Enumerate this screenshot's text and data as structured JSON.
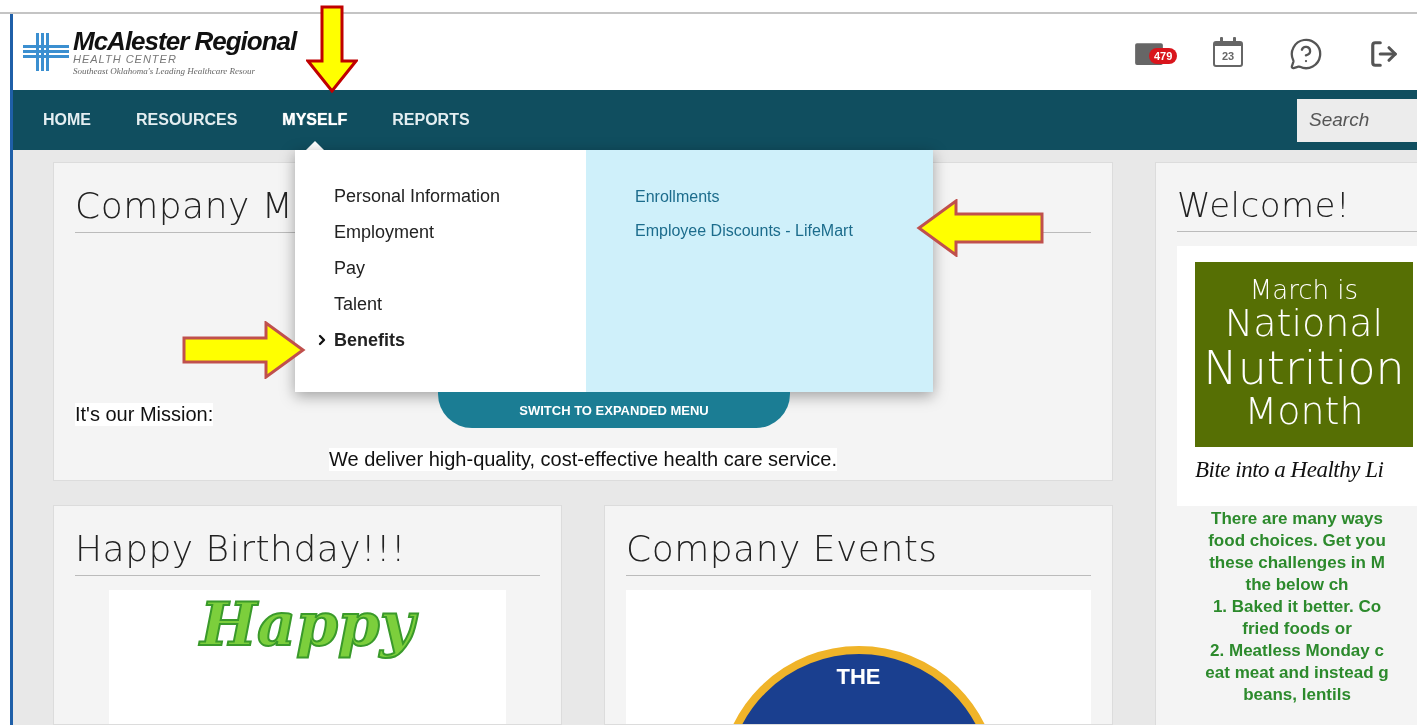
{
  "header": {
    "logo": {
      "name": "McAlester Regional",
      "subtitle": "HEALTH CENTER",
      "tagline": "Southeast Oklahoma's Leading Healthcare Resour"
    },
    "mail_badge": "479",
    "calendar_day": "23"
  },
  "nav": {
    "items": [
      {
        "label": "HOME",
        "selected": false
      },
      {
        "label": "RESOURCES",
        "selected": false
      },
      {
        "label": "MYSELF",
        "selected": true
      },
      {
        "label": "REPORTS",
        "selected": false
      }
    ],
    "search": {
      "placeholder": "Search"
    }
  },
  "dropdown": {
    "left_items": [
      {
        "label": "Personal Information",
        "selected": false
      },
      {
        "label": "Employment",
        "selected": false
      },
      {
        "label": "Pay",
        "selected": false
      },
      {
        "label": "Talent",
        "selected": false
      },
      {
        "label": "Benefits",
        "selected": true
      }
    ],
    "right_items": [
      "Enrollments",
      "Employee Discounts - LifeMart"
    ],
    "switch_button": "SWITCH TO EXPANDED MENU"
  },
  "mission_card": {
    "title": "Company M",
    "label": "It's our Mission:",
    "statement": "We deliver high-quality, cost-effective health care service."
  },
  "birthday_card": {
    "title": "Happy Birthday!!!",
    "image_text": "Happy"
  },
  "events_card": {
    "title": "Company Events",
    "image_text": "THE"
  },
  "welcome_card": {
    "title": "Welcome!",
    "poster": {
      "lines": [
        "March is",
        "National",
        "Nutrition",
        "Month"
      ],
      "script": "Bite into a Healthy Li"
    },
    "text_lines": [
      "There are many ways",
      "food choices. Get you",
      "these challenges in M",
      "the below ch",
      "1. Baked it better. Co",
      "fried foods or",
      "2. Meatless Monday c",
      "eat meat and instead g",
      "beans, lentils"
    ]
  }
}
